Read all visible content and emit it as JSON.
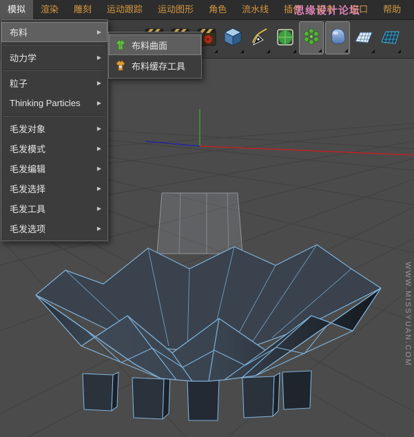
{
  "watermarks": {
    "forum_name": "思缘设计论坛",
    "site_url": "WWW.MISSYUAN.COM"
  },
  "menubar": {
    "items": [
      {
        "label": "模拟",
        "active": true
      },
      {
        "label": "渲染"
      },
      {
        "label": "雕刻"
      },
      {
        "label": "运动跟踪"
      },
      {
        "label": "运动图形"
      },
      {
        "label": "角色"
      },
      {
        "label": "流水线"
      },
      {
        "label": "插件"
      },
      {
        "label": "脚本"
      },
      {
        "label": "窗口"
      },
      {
        "label": "帮助"
      }
    ]
  },
  "simulate_menu": {
    "arrow_glyph": "▶",
    "items": [
      {
        "label": "布料",
        "highlighted": true,
        "has_submenu": true
      },
      {
        "label": "动力学",
        "has_submenu": true
      },
      {
        "label": "粒子",
        "has_submenu": true
      },
      {
        "label": "Thinking Particles",
        "has_submenu": true
      },
      {
        "label": "毛发对象",
        "has_submenu": true
      },
      {
        "label": "毛发模式",
        "has_submenu": true
      },
      {
        "label": "毛发编辑",
        "has_submenu": true
      },
      {
        "label": "毛发选择",
        "has_submenu": true
      },
      {
        "label": "毛发工具",
        "has_submenu": true
      },
      {
        "label": "毛发选项",
        "has_submenu": true
      }
    ]
  },
  "cloth_submenu": {
    "items": [
      {
        "label": "布料曲面",
        "icon": "cloth-surface-icon",
        "highlighted": true
      },
      {
        "label": "布料缓存工具",
        "icon": "cloth-cache-icon",
        "highlighted": false
      }
    ]
  },
  "toolbar": {
    "icons": [
      "render-view-icon",
      "render-picture-viewer-icon",
      "render-settings-icon",
      "cube-primitive-icon",
      "spline-pen-icon",
      "subdivision-surface-icon",
      "array-icon",
      "metaball-icon",
      "floor-plane-icon",
      "landscape-icon"
    ],
    "highlighted_icons": [
      "array-icon",
      "metaball-icon"
    ]
  },
  "viewport": {
    "colors": {
      "background": "#4b4b4b",
      "grid_line": "#404040",
      "wireframe": "#7fb2da",
      "axis_x": "#c02222",
      "axis_y": "#35a02c",
      "axis_z": "#23279b"
    }
  }
}
